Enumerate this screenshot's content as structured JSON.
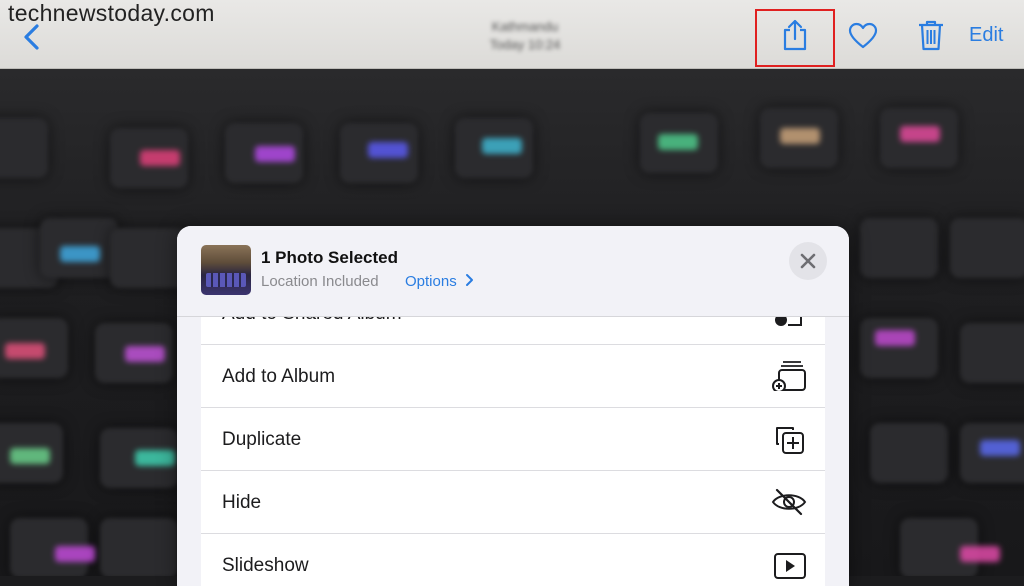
{
  "watermark": "technewstoday.com",
  "nav": {
    "title_line1": "Kathmandu",
    "title_line2": "Today  10:24",
    "edit_label": "Edit"
  },
  "share_sheet": {
    "title": "1 Photo Selected",
    "subtitle": "Location Included",
    "options_label": "Options",
    "actions": [
      {
        "label": "Add to Shared Album",
        "icon": "shared-album-icon"
      },
      {
        "label": "Add to Album",
        "icon": "add-album-icon"
      },
      {
        "label": "Duplicate",
        "icon": "duplicate-icon"
      },
      {
        "label": "Hide",
        "icon": "eye-slash-icon"
      },
      {
        "label": "Slideshow",
        "icon": "play-icon"
      }
    ]
  },
  "colors": {
    "accent": "#2a7de1",
    "highlight_box": "#e02020",
    "sheet_bg": "#f2f2f7"
  }
}
